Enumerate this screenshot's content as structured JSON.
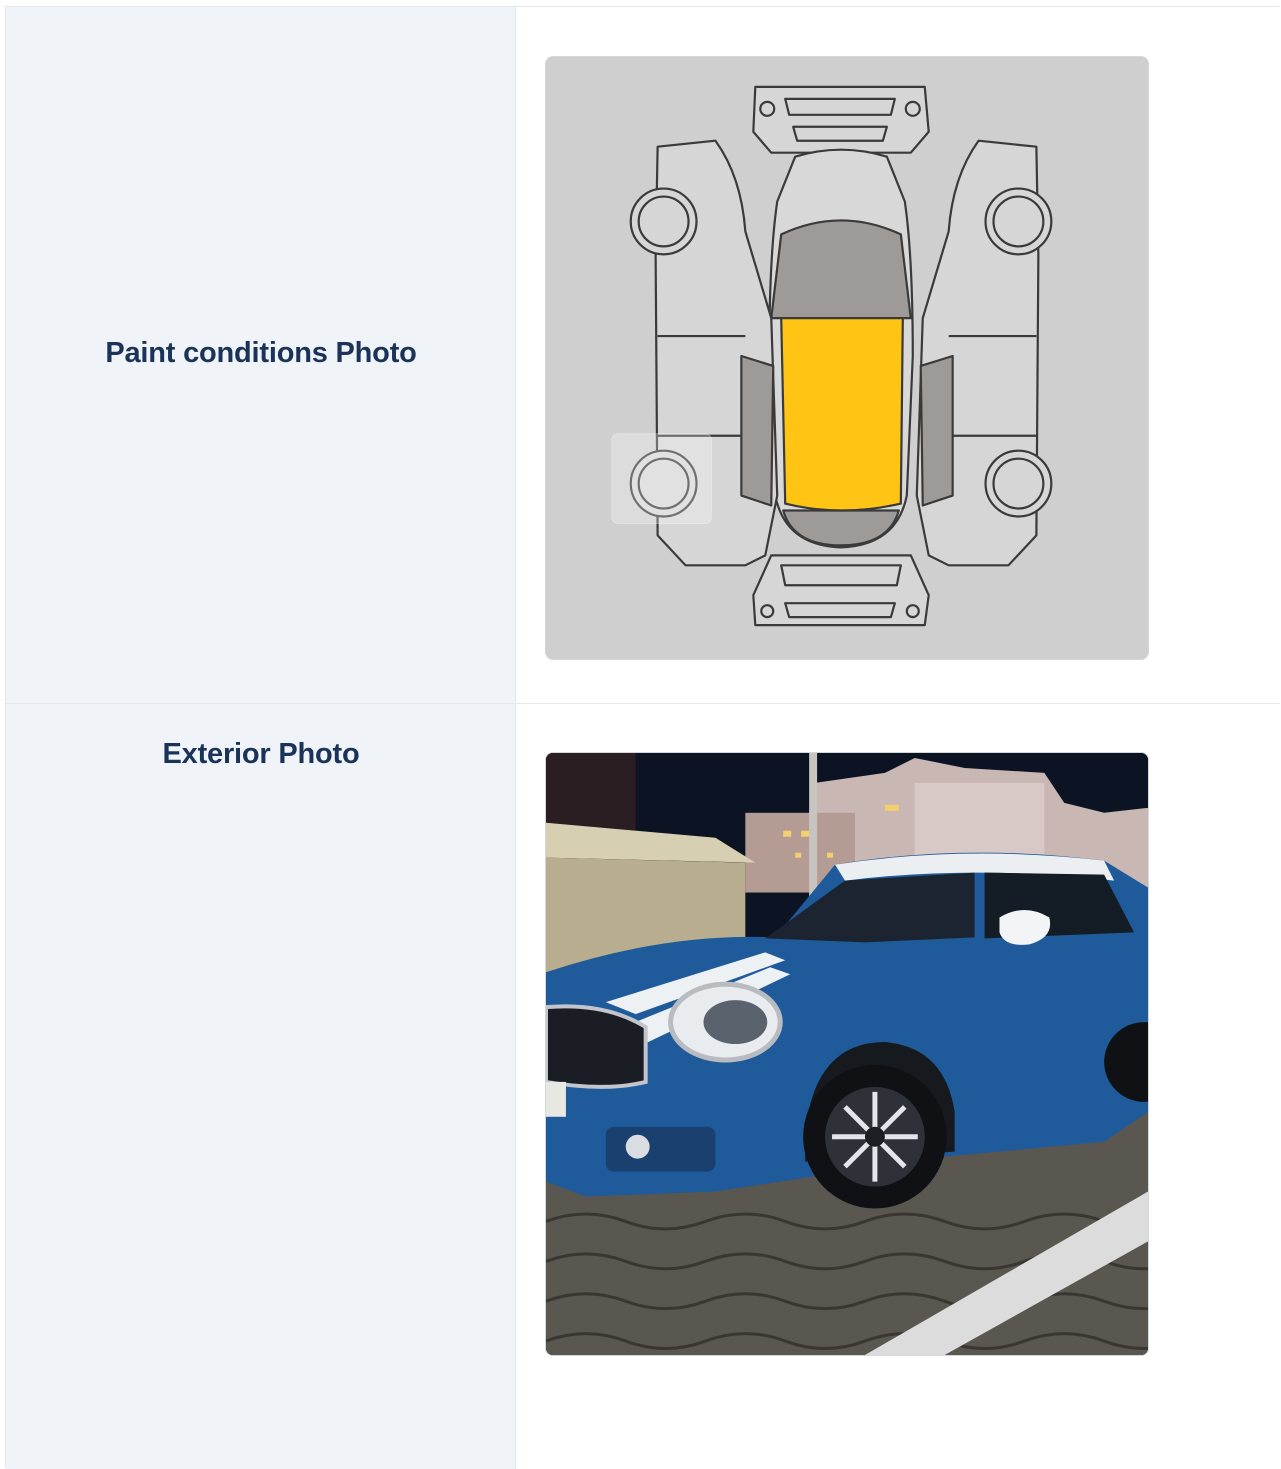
{
  "rows": [
    {
      "label": "Paint conditions Photo",
      "image": "car-paint-diagram",
      "highlighted_panel": "roof",
      "highlight_color": "#ffc414"
    },
    {
      "label": "Exterior Photo",
      "image": "blue-mini-countryman-photo"
    }
  ],
  "colors": {
    "label_text": "#1b3358",
    "label_cell_bg": "#f0f4f9",
    "border": "#e3e8ef",
    "diagram_bg": "#cfcfcf"
  }
}
